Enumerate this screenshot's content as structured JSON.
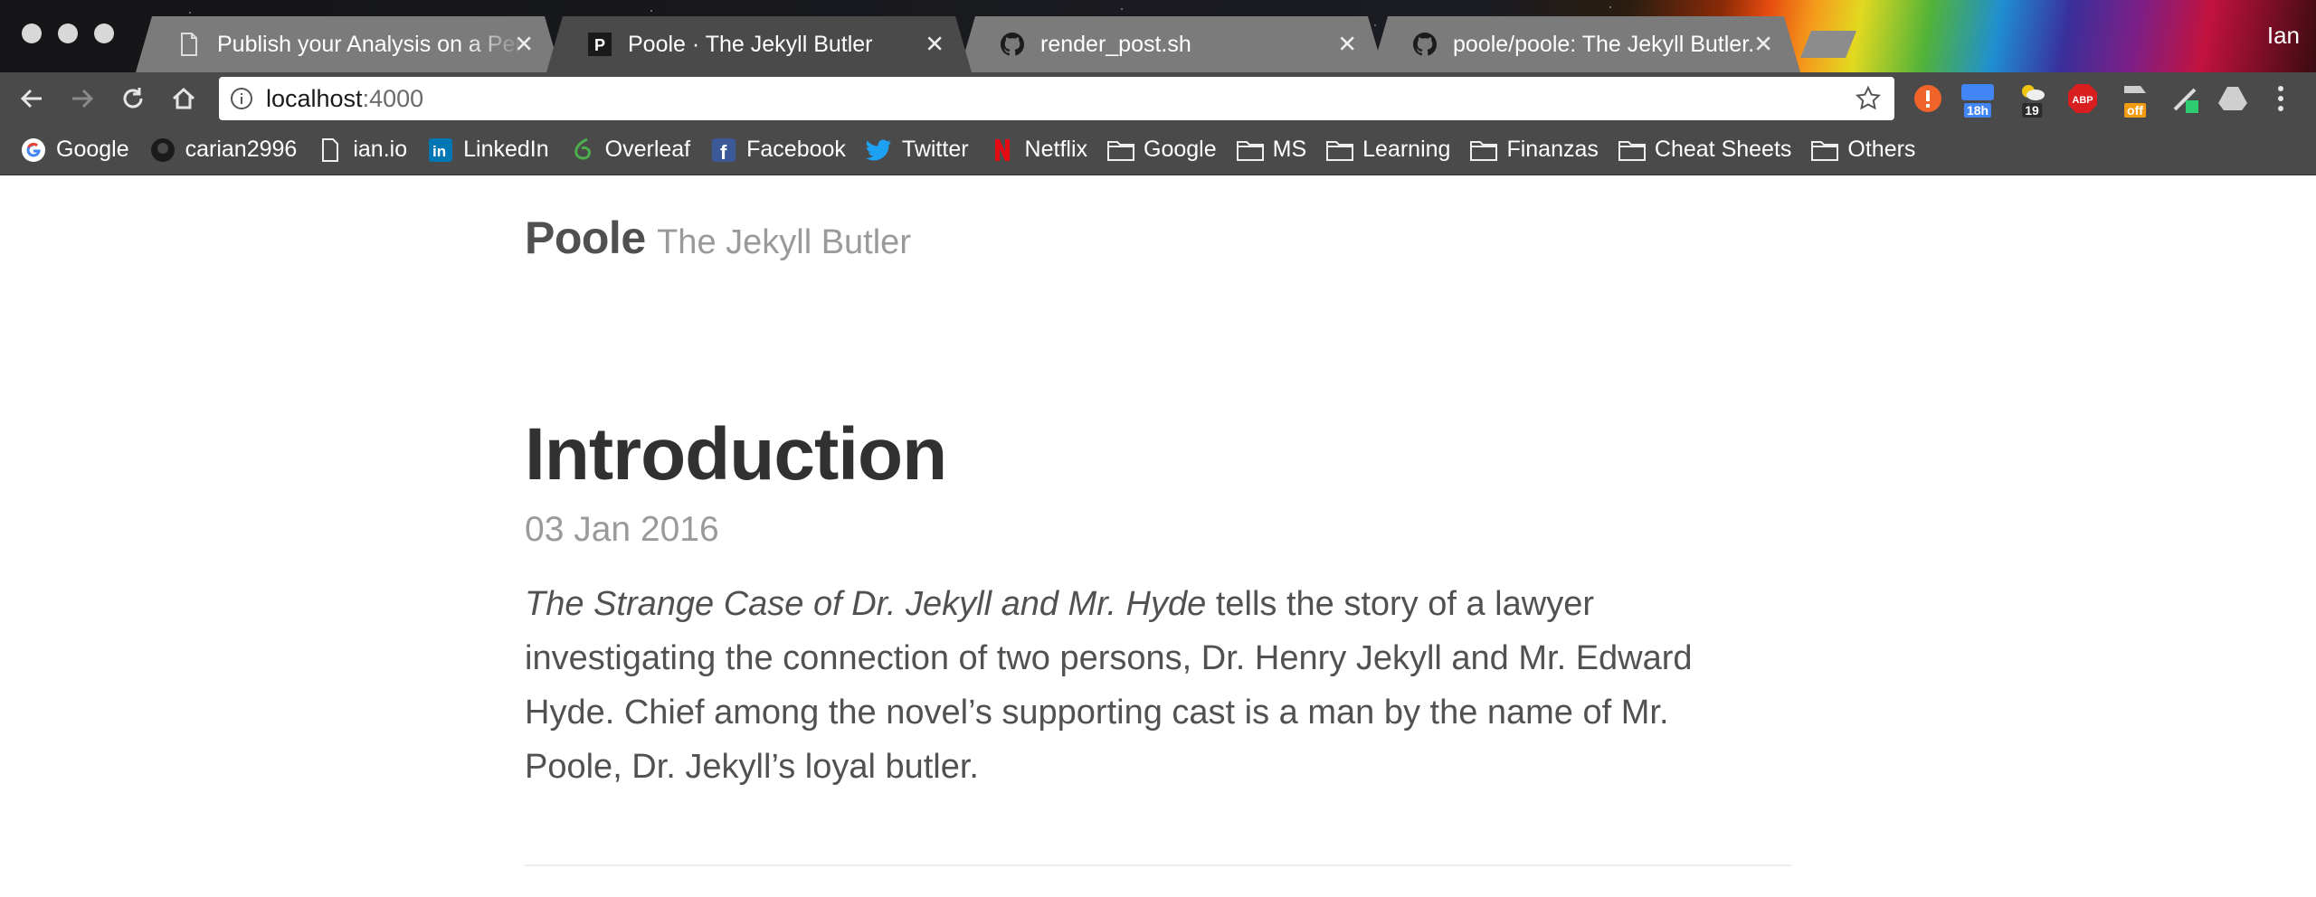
{
  "browser": {
    "profile_name": "Ian",
    "tabs": [
      {
        "title": "Publish your Analysis on a Pers",
        "icon": "document-icon",
        "active": false
      },
      {
        "title": "Poole · The Jekyll Butler",
        "icon": "poole-p-icon",
        "active": true
      },
      {
        "title": "render_post.sh",
        "icon": "github-icon",
        "active": false
      },
      {
        "title": "poole/poole: The Jekyll Butler.",
        "icon": "github-icon",
        "active": false
      }
    ],
    "address": {
      "host": "localhost",
      "port": ":4000"
    },
    "extensions": [
      {
        "name": "alert-icon",
        "color": "#f0642a",
        "badge": ""
      },
      {
        "name": "calendar-icon",
        "color": "#4285f4",
        "badge": "18h"
      },
      {
        "name": "weather-icon",
        "color": "#3a3a3a",
        "badge": "19"
      },
      {
        "name": "adblock-icon",
        "color": "#d81e1e",
        "badge": "ABP"
      },
      {
        "name": "shopping-icon",
        "color": "#f39c12",
        "badge": "off"
      },
      {
        "name": "pen-icon",
        "color": "#2ecc71",
        "badge": ""
      },
      {
        "name": "drive-icon",
        "color": "#cfcfcf",
        "badge": ""
      }
    ],
    "bookmarks": [
      {
        "label": "Google",
        "icon": "google-icon"
      },
      {
        "label": "carian2996",
        "icon": "github-icon"
      },
      {
        "label": "ian.io",
        "icon": "document-icon"
      },
      {
        "label": "LinkedIn",
        "icon": "linkedin-icon"
      },
      {
        "label": "Overleaf",
        "icon": "overleaf-icon"
      },
      {
        "label": "Facebook",
        "icon": "facebook-icon"
      },
      {
        "label": "Twitter",
        "icon": "twitter-icon"
      },
      {
        "label": "Netflix",
        "icon": "netflix-icon"
      },
      {
        "label": "Google",
        "icon": "folder-icon"
      },
      {
        "label": "MS",
        "icon": "folder-icon"
      },
      {
        "label": "Learning",
        "icon": "folder-icon"
      },
      {
        "label": "Finanzas",
        "icon": "folder-icon"
      },
      {
        "label": "Cheat Sheets",
        "icon": "folder-icon"
      },
      {
        "label": "Others",
        "icon": "folder-icon"
      }
    ]
  },
  "site": {
    "title": "Poole",
    "tagline": "The Jekyll Butler"
  },
  "post": {
    "title": "Introduction",
    "date": "03 Jan 2016",
    "body_em": "The Strange Case of Dr. Jekyll and Mr. Hyde",
    "body_rest": " tells the story of a lawyer investigating the connection of two persons, Dr. Henry Jekyll and Mr. Edward Hyde. Chief among the novel’s supporting cast is a man by the name of Mr. Poole, Dr. Jekyll’s loyal butler."
  },
  "colors": {
    "page_bg": "#ffffff",
    "heading": "#313131",
    "body_text": "#515151",
    "muted": "#9a9a9a",
    "chrome_dark": "#4a4a4a"
  }
}
